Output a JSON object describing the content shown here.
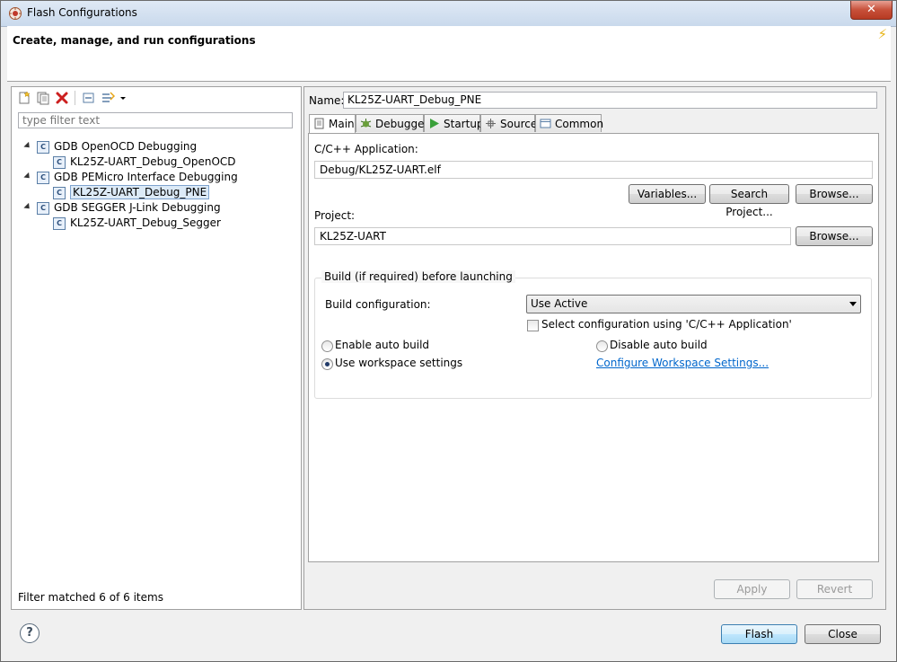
{
  "window": {
    "title": "Flash Configurations",
    "close_glyph": "✕"
  },
  "header": {
    "title": "Create, manage, and run configurations"
  },
  "left": {
    "filter_placeholder": "type filter text",
    "tree": [
      {
        "label": "GDB OpenOCD Debugging",
        "level": 0
      },
      {
        "label": "KL25Z-UART_Debug_OpenOCD",
        "level": 1
      },
      {
        "label": "GDB PEMicro Interface Debugging",
        "level": 0
      },
      {
        "label": "KL25Z-UART_Debug_PNE",
        "level": 1,
        "selected": true
      },
      {
        "label": "GDB SEGGER J-Link Debugging",
        "level": 0
      },
      {
        "label": "KL25Z-UART_Debug_Segger",
        "level": 1
      }
    ],
    "status": "Filter matched 6 of 6 items"
  },
  "right": {
    "name_label": "Name:",
    "name_value": "KL25Z-UART_Debug_PNE",
    "tabs": [
      {
        "label": "Main",
        "icon": "main-tab-icon"
      },
      {
        "label": "Debugger",
        "icon": "debugger-tab-icon"
      },
      {
        "label": "Startup",
        "icon": "startup-tab-icon"
      },
      {
        "label": "Source",
        "icon": "source-tab-icon"
      },
      {
        "label": "Common",
        "icon": "common-tab-icon"
      }
    ],
    "app_label": "C/C++ Application:",
    "app_value": "Debug/KL25Z-UART.elf",
    "variables_btn": "Variables...",
    "search_project_btn": "Search Project...",
    "browse_btn": "Browse...",
    "project_label": "Project:",
    "project_value": "KL25Z-UART",
    "build_group_title": "Build (if required) before launching",
    "build_config_label": "Build configuration:",
    "build_config_value": "Use Active",
    "select_config_chk": "Select configuration using 'C/C++ Application'",
    "enable_auto_build": "Enable auto build",
    "disable_auto_build": "Disable auto build",
    "use_workspace": "Use workspace settings",
    "configure_link": "Configure Workspace Settings...",
    "apply_btn": "Apply",
    "revert_btn": "Revert"
  },
  "footer": {
    "help_glyph": "?",
    "flash_btn": "Flash",
    "close_btn": "Close"
  },
  "colors": {
    "link": "#0066cc",
    "accent": "#3c7fb1",
    "delete": "#cc1f1f"
  }
}
